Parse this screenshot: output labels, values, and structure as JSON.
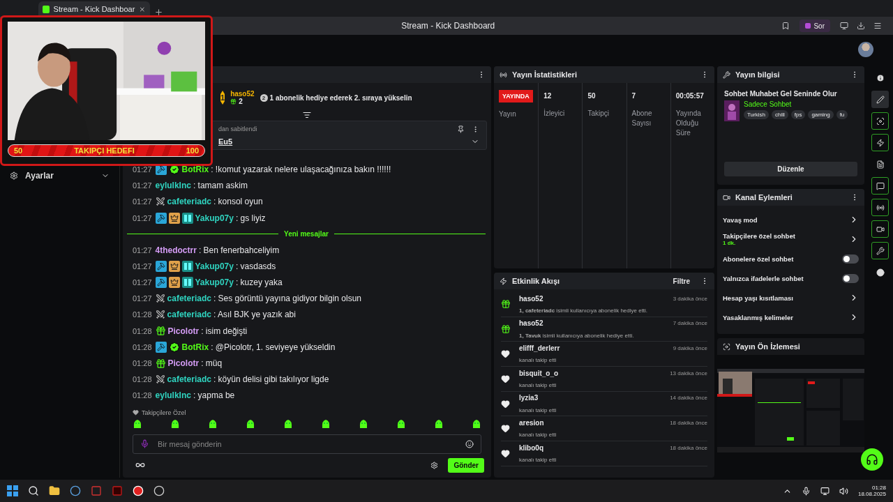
{
  "browser": {
    "tab_title": "Stream - Kick Dashboar",
    "window_title": "Stream - Kick Dashboard",
    "ask_button": "Sor"
  },
  "overlay": {
    "goal_start": "50",
    "goal_label": "TAKIPÇI HEDEFI",
    "goal_end": "100"
  },
  "sidebar": {
    "settings": "Ayarlar"
  },
  "chat": {
    "leader": {
      "rank": "1",
      "name": "haso52",
      "count": "2"
    },
    "goal": {
      "rank": "2",
      "text": "1 abonelik hediye ederek 2. sıraya yükselin"
    },
    "pinned": {
      "label": "dan sabitlendi",
      "message": "Eu5"
    },
    "messages": [
      {
        "kind": "message",
        "time": "01:27",
        "badges": [
          {
            "kind": "mod"
          },
          {
            "kind": "verified"
          }
        ],
        "user": "BotRix",
        "color": "#53fc18",
        "text": ": !komut yazarak nelere ulaşacağınıza bakın !!!!!!"
      },
      {
        "kind": "message",
        "time": "01:27",
        "user": "eylulkInc",
        "color": "#2fd4c0",
        "text": ": tamam askim"
      },
      {
        "kind": "message",
        "time": "01:27",
        "badges": [
          {
            "kind": "sword"
          }
        ],
        "user": "cafeteriadc",
        "color": "#2fd4c0",
        "text": ": konsol oyun"
      },
      {
        "kind": "message",
        "time": "01:27",
        "badges": [
          {
            "kind": "mod"
          },
          {
            "kind": "crown"
          },
          {
            "kind": "og"
          }
        ],
        "user": "Yakup07y",
        "color": "#2fd4c0",
        "text": ": gs liyiz"
      },
      {
        "kind": "divider",
        "text": "Yeni mesajlar"
      },
      {
        "kind": "message",
        "time": "01:27",
        "user": "4thedoctrr",
        "color": "#d49cf5",
        "text": ": Ben fenerbahceliyim"
      },
      {
        "kind": "message",
        "time": "01:27",
        "badges": [
          {
            "kind": "mod"
          },
          {
            "kind": "crown"
          },
          {
            "kind": "og"
          }
        ],
        "user": "Yakup07y",
        "color": "#2fd4c0",
        "text": ": vasdasds"
      },
      {
        "kind": "message",
        "time": "01:27",
        "badges": [
          {
            "kind": "mod"
          },
          {
            "kind": "crown"
          },
          {
            "kind": "og"
          }
        ],
        "user": "Yakup07y",
        "color": "#2fd4c0",
        "text": ": kuzey yaka"
      },
      {
        "kind": "message",
        "time": "01:27",
        "badges": [
          {
            "kind": "sword"
          }
        ],
        "user": "cafeteriadc",
        "color": "#2fd4c0",
        "text": ": Ses görüntü yayına gidiyor bilgin olsun"
      },
      {
        "kind": "message",
        "time": "01:28",
        "badges": [
          {
            "kind": "sword"
          }
        ],
        "user": "cafeteriadc",
        "color": "#2fd4c0",
        "text": ": Asıl BJK ye yazık abi"
      },
      {
        "kind": "message",
        "time": "01:28",
        "badges": [
          {
            "kind": "gift"
          }
        ],
        "user": "Picolotr",
        "color": "#d49cf5",
        "text": ": isim değişti"
      },
      {
        "kind": "message",
        "time": "01:28",
        "badges": [
          {
            "kind": "mod"
          },
          {
            "kind": "verified"
          }
        ],
        "user": "BotRix",
        "color": "#53fc18",
        "text": ": @Picolotr, 1. seviyeye yükseldin"
      },
      {
        "kind": "message",
        "time": "01:28",
        "badges": [
          {
            "kind": "gift"
          }
        ],
        "user": "Picolotr",
        "color": "#d49cf5",
        "text": ": müq"
      },
      {
        "kind": "message",
        "time": "01:28",
        "badges": [
          {
            "kind": "sword"
          }
        ],
        "user": "cafeteriadc",
        "color": "#2fd4c0",
        "text": ": köyün delisi gibi takılıyor ligde"
      },
      {
        "kind": "message",
        "time": "01:28",
        "user": "eylulkInc",
        "color": "#2fd4c0",
        "text": ": yapma be"
      }
    ],
    "followers_only": "Takipçilere Özel",
    "placeholder": "Bir mesaj gönderin",
    "send": "Gönder"
  },
  "stats": {
    "title": "Yayın İstatistikleri",
    "columns": [
      {
        "kind": "badge",
        "value": "YAYINDA",
        "label": "Yayın"
      },
      {
        "kind": "number",
        "value": "12",
        "label": "İzleyici"
      },
      {
        "kind": "number",
        "value": "50",
        "label": "Takipçi"
      },
      {
        "kind": "number",
        "value": "7",
        "label": "Abone Sayısı"
      },
      {
        "kind": "number",
        "value": "00:05:57",
        "label": "Yayında Olduğu Süre"
      }
    ]
  },
  "activity": {
    "title": "Etkinlik Akışı",
    "filter": "Filtre",
    "events": [
      {
        "kind": "gift",
        "user": "haso52",
        "detail": "**1, cafeteriadc** isimli kullanıcıya abonelik hediye etti.",
        "time": "3 dakika önce"
      },
      {
        "kind": "gift",
        "user": "haso52",
        "detail": "**1, Tavuk** isimli kullanıcıya abonelik hediye etti.",
        "time": "7 dakika önce"
      },
      {
        "kind": "follow",
        "user": "elifff_derlerr",
        "detail": "kanalı takip etti",
        "time": "9 dakika önce"
      },
      {
        "kind": "follow",
        "user": "bisquit_o_o",
        "detail": "kanalı takip etti",
        "time": "13 dakika önce"
      },
      {
        "kind": "follow",
        "user": "lyzia3",
        "detail": "kanalı takip etti",
        "time": "14 dakika önce"
      },
      {
        "kind": "follow",
        "user": "aresion",
        "detail": "kanalı takip etti",
        "time": "18 dakika önce"
      },
      {
        "kind": "follow",
        "user": "klibo0q",
        "detail": "kanalı takip etti",
        "time": "18 dakika önce"
      }
    ]
  },
  "stream_info": {
    "title": "Yayın bilgisi",
    "stream_title": "Sohbet Muhabet Gel Seninde Olur",
    "category": "Sadece Sohbet",
    "tags": [
      "Turkish",
      "chill",
      "fps",
      "gaming",
      "fu"
    ],
    "edit": "Düzenle"
  },
  "channel_actions": {
    "title": "Kanal Eylemleri",
    "items": [
      {
        "kind": "link",
        "label": "Yavaş mod"
      },
      {
        "kind": "link",
        "label": "Takipçilere özel sohbet",
        "value": "1 dk."
      },
      {
        "kind": "toggle",
        "label": "Abonelere özel sohbet",
        "on": false
      },
      {
        "kind": "toggle",
        "label": "Yalnızca ifadelerle sohbet",
        "on": false
      },
      {
        "kind": "link",
        "label": "Hesap yaşı kısıtlaması"
      },
      {
        "kind": "link",
        "label": "Yasaklanmış kelimeler"
      }
    ]
  },
  "preview": {
    "title": "Yayın Ön İzlemesi"
  },
  "rail": [
    {
      "kind": "info",
      "selected": false,
      "on": false
    },
    {
      "kind": "edit",
      "selected": true,
      "on": false
    },
    {
      "kind": "preview",
      "selected": false,
      "on": true
    },
    {
      "kind": "activity",
      "selected": false,
      "on": true
    },
    {
      "kind": "notes",
      "selected": false,
      "on": false
    },
    {
      "kind": "chat",
      "selected": false,
      "on": true
    },
    {
      "kind": "stats",
      "selected": false,
      "on": true
    },
    {
      "kind": "actions",
      "selected": false,
      "on": true
    },
    {
      "kind": "info-panel",
      "selected": false,
      "on": true
    },
    {
      "kind": "more",
      "selected": false,
      "on": false
    }
  ],
  "taskbar": {
    "time": "01:28",
    "date": "18.08.2025"
  }
}
